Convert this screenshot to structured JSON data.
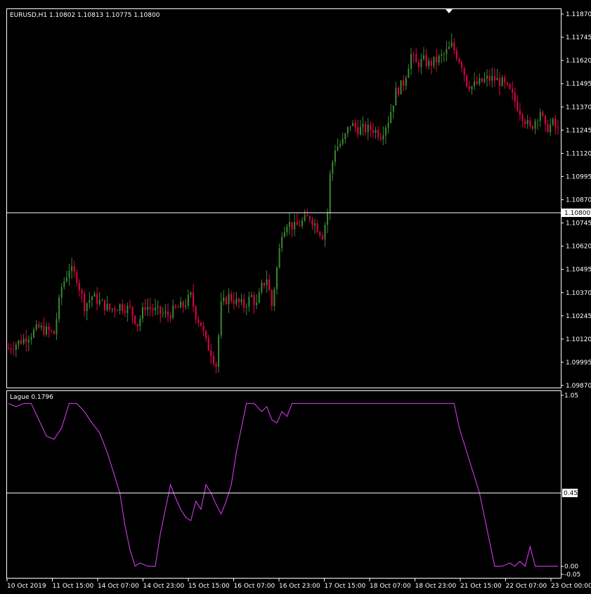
{
  "chart_data": [
    {
      "type": "candlestick",
      "title": "EURUSD,H1  1.10802 1.10813 1.10775 1.10800",
      "symbol": "EURUSD",
      "timeframe": "H1",
      "ohlc_current": [
        1.10802,
        1.10813,
        1.10775,
        1.108
      ],
      "ylim": [
        1.0987,
        1.1187
      ],
      "y_ticks": [
        "1.11870",
        "1.11745",
        "1.11620",
        "1.11495",
        "1.11370",
        "1.11245",
        "1.11120",
        "1.10995",
        "1.10870",
        "1.10745",
        "1.10620",
        "1.10495",
        "1.10370",
        "1.10245",
        "1.10120",
        "1.09995",
        "1.09870"
      ],
      "price_line": 1.108,
      "price_label": "1.10800",
      "colors": {
        "bull": "#3a8a2f",
        "bear": "#e6004c",
        "wick": "#ffffff"
      },
      "close_path": [
        [
          0,
          1.1007
        ],
        [
          6,
          1.1012
        ],
        [
          12,
          1.1018
        ],
        [
          18,
          1.1015
        ],
        [
          21,
          1.104
        ],
        [
          24,
          1.105
        ],
        [
          27,
          1.1045
        ],
        [
          30,
          1.103
        ],
        [
          33,
          1.1035
        ],
        [
          36,
          1.1032
        ],
        [
          40,
          1.1028
        ],
        [
          44,
          1.103
        ],
        [
          48,
          1.1028
        ],
        [
          51,
          1.102
        ],
        [
          54,
          1.103
        ],
        [
          57,
          1.1028
        ],
        [
          60,
          1.1026
        ],
        [
          63,
          1.1025
        ],
        [
          66,
          1.1028
        ],
        [
          69,
          1.103
        ],
        [
          72,
          1.1035
        ],
        [
          74,
          1.1025
        ],
        [
          76,
          1.102
        ],
        [
          78,
          1.101
        ],
        [
          80,
          1.1005
        ],
        [
          82,
          1.0998
        ],
        [
          84,
          1.103
        ],
        [
          87,
          1.1035
        ],
        [
          90,
          1.1032
        ],
        [
          93,
          1.103
        ],
        [
          96,
          1.1035
        ],
        [
          98,
          1.103
        ],
        [
          100,
          1.104
        ],
        [
          102,
          1.1045
        ],
        [
          104,
          1.103
        ],
        [
          106,
          1.105
        ],
        [
          108,
          1.107
        ],
        [
          110,
          1.1075
        ],
        [
          113,
          1.1072
        ],
        [
          116,
          1.1075
        ],
        [
          119,
          1.1078
        ],
        [
          122,
          1.1072
        ],
        [
          124,
          1.1068
        ],
        [
          126,
          1.108
        ],
        [
          127,
          1.11
        ],
        [
          129,
          1.1115
        ],
        [
          132,
          1.1118
        ],
        [
          135,
          1.1128
        ],
        [
          138,
          1.1125
        ],
        [
          141,
          1.1125
        ],
        [
          144,
          1.1125
        ],
        [
          147,
          1.1122
        ],
        [
          150,
          1.113
        ],
        [
          153,
          1.1145
        ],
        [
          156,
          1.115
        ],
        [
          159,
          1.1165
        ],
        [
          161,
          1.116
        ],
        [
          164,
          1.1162
        ],
        [
          166,
          1.116
        ],
        [
          169,
          1.1162
        ],
        [
          172,
          1.1165
        ],
        [
          175,
          1.117
        ],
        [
          177,
          1.1165
        ],
        [
          179,
          1.116
        ],
        [
          181,
          1.115
        ],
        [
          183,
          1.1148
        ],
        [
          186,
          1.115
        ],
        [
          189,
          1.1152
        ],
        [
          192,
          1.1152
        ],
        [
          195,
          1.115
        ],
        [
          198,
          1.1145
        ],
        [
          200,
          1.114
        ],
        [
          202,
          1.1135
        ],
        [
          204,
          1.113
        ],
        [
          206,
          1.1125
        ],
        [
          208,
          1.113
        ],
        [
          210,
          1.1135
        ],
        [
          212,
          1.1125
        ],
        [
          215,
          1.1128
        ],
        [
          217,
          1.1124
        ]
      ]
    },
    {
      "type": "line",
      "title": "Lague 0.1796",
      "ylim": [
        -0.05,
        1.05
      ],
      "y_ticks": [
        "1.05",
        "0.00",
        "-0.05"
      ],
      "level_line": 0.45,
      "level_label": "0.45",
      "color": "#e040fb",
      "points": [
        [
          0,
          1.0
        ],
        [
          3,
          0.98
        ],
        [
          6,
          1.0
        ],
        [
          9,
          1.0
        ],
        [
          12,
          0.9
        ],
        [
          15,
          0.8
        ],
        [
          18,
          0.78
        ],
        [
          21,
          0.85
        ],
        [
          24,
          1.0
        ],
        [
          27,
          1.0
        ],
        [
          30,
          0.95
        ],
        [
          33,
          0.88
        ],
        [
          36,
          0.82
        ],
        [
          39,
          0.7
        ],
        [
          42,
          0.55
        ],
        [
          44,
          0.45
        ],
        [
          46,
          0.25
        ],
        [
          48,
          0.1
        ],
        [
          50,
          0.0
        ],
        [
          52,
          0.02
        ],
        [
          55,
          0.0
        ],
        [
          58,
          0.0
        ],
        [
          60,
          0.2
        ],
        [
          62,
          0.35
        ],
        [
          64,
          0.5
        ],
        [
          66,
          0.42
        ],
        [
          68,
          0.35
        ],
        [
          70,
          0.3
        ],
        [
          72,
          0.28
        ],
        [
          74,
          0.4
        ],
        [
          76,
          0.35
        ],
        [
          78,
          0.5
        ],
        [
          80,
          0.45
        ],
        [
          82,
          0.38
        ],
        [
          84,
          0.32
        ],
        [
          86,
          0.4
        ],
        [
          88,
          0.5
        ],
        [
          90,
          0.7
        ],
        [
          92,
          0.85
        ],
        [
          94,
          1.0
        ],
        [
          97,
          1.0
        ],
        [
          100,
          0.95
        ],
        [
          102,
          0.98
        ],
        [
          104,
          0.9
        ],
        [
          106,
          0.88
        ],
        [
          108,
          0.95
        ],
        [
          110,
          0.92
        ],
        [
          112,
          1.0
        ],
        [
          115,
          1.0
        ],
        [
          120,
          1.0
        ],
        [
          130,
          1.0
        ],
        [
          140,
          1.0
        ],
        [
          150,
          1.0
        ],
        [
          160,
          1.0
        ],
        [
          170,
          1.0
        ],
        [
          176,
          1.0
        ],
        [
          178,
          0.85
        ],
        [
          180,
          0.75
        ],
        [
          182,
          0.65
        ],
        [
          184,
          0.55
        ],
        [
          186,
          0.45
        ],
        [
          188,
          0.3
        ],
        [
          190,
          0.15
        ],
        [
          192,
          0.0
        ],
        [
          195,
          0.0
        ],
        [
          198,
          0.02
        ],
        [
          200,
          0.0
        ],
        [
          202,
          0.03
        ],
        [
          204,
          0.0
        ],
        [
          206,
          0.12
        ],
        [
          208,
          0.0
        ],
        [
          210,
          0.0
        ],
        [
          214,
          0.0
        ],
        [
          217,
          0.0
        ]
      ]
    }
  ],
  "x_axis": {
    "tick_labels": [
      "10 Oct 2019",
      "11 Oct 15:00",
      "14 Oct 07:00",
      "14 Oct 23:00",
      "15 Oct 15:00",
      "16 Oct 07:00",
      "16 Oct 23:00",
      "17 Oct 15:00",
      "18 Oct 07:00",
      "18 Oct 23:00",
      "21 Oct 15:00",
      "22 Oct 07:00",
      "23 Oct 00:00"
    ]
  },
  "theme": {
    "background": "#000000",
    "axis_text": "#ffffff",
    "border": "#ffffff"
  }
}
